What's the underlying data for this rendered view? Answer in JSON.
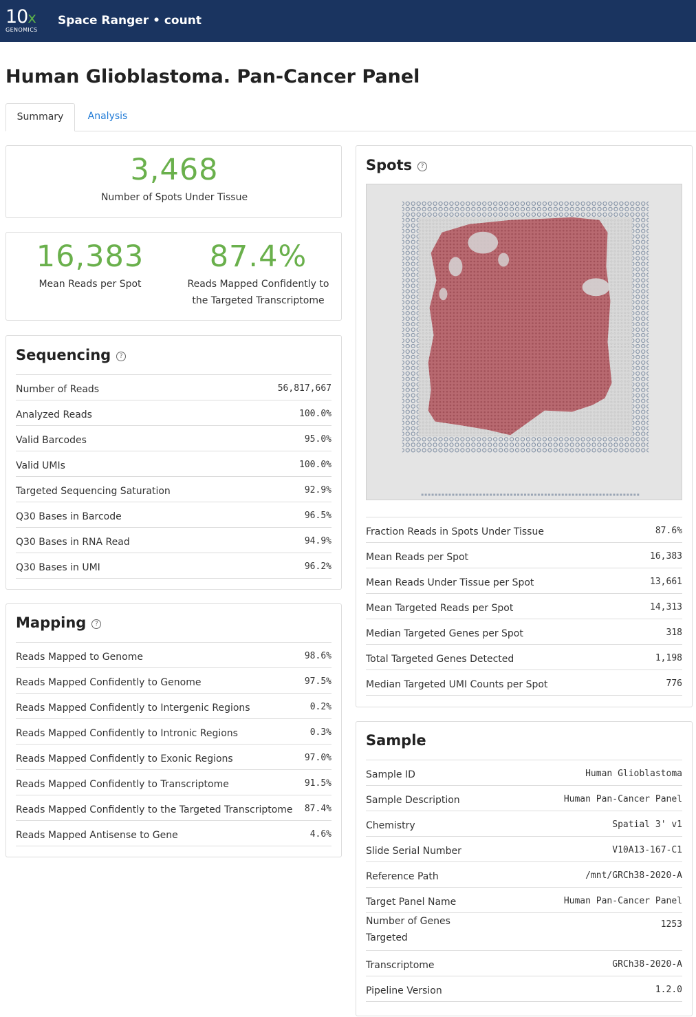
{
  "header": {
    "logo_main": "10",
    "logo_x": "x",
    "logo_sub": "GENOMICS",
    "app_title": "Space Ranger • count"
  },
  "page_title": "Human Glioblastoma. Pan-Cancer Panel",
  "tabs": [
    {
      "label": "Summary",
      "active": true
    },
    {
      "label": "Analysis",
      "active": false
    }
  ],
  "hero": {
    "spots_value": "3,468",
    "spots_label": "Number of Spots Under Tissue",
    "reads_value": "16,383",
    "reads_label": "Mean Reads per Spot",
    "mapped_value": "87.4%",
    "mapped_label_1": "Reads Mapped Confidently to",
    "mapped_label_2": "the Targeted Transcriptome"
  },
  "sequencing": {
    "title": "Sequencing",
    "help_icon": "?",
    "rows": [
      {
        "label": "Number of Reads",
        "value": "56,817,667"
      },
      {
        "label": "Analyzed Reads",
        "value": "100.0%"
      },
      {
        "label": "Valid Barcodes",
        "value": "95.0%"
      },
      {
        "label": "Valid UMIs",
        "value": "100.0%"
      },
      {
        "label": "Targeted Sequencing Saturation",
        "value": "92.9%"
      },
      {
        "label": "Q30 Bases in Barcode",
        "value": "96.5%"
      },
      {
        "label": "Q30 Bases in RNA Read",
        "value": "94.9%"
      },
      {
        "label": "Q30 Bases in UMI",
        "value": "96.2%"
      }
    ]
  },
  "mapping": {
    "title": "Mapping",
    "help_icon": "?",
    "rows": [
      {
        "label": "Reads Mapped to Genome",
        "value": "98.6%"
      },
      {
        "label": "Reads Mapped Confidently to Genome",
        "value": "97.5%"
      },
      {
        "label": "Reads Mapped Confidently to Intergenic Regions",
        "value": "0.2%"
      },
      {
        "label": "Reads Mapped Confidently to Intronic Regions",
        "value": "0.3%"
      },
      {
        "label": "Reads Mapped Confidently to Exonic Regions",
        "value": "97.0%"
      },
      {
        "label": "Reads Mapped Confidently to Transcriptome",
        "value": "91.5%"
      },
      {
        "label": "Reads Mapped Confidently to the Targeted Transcriptome",
        "value": "87.4%"
      },
      {
        "label": "Reads Mapped Antisense to Gene",
        "value": "4.6%"
      }
    ]
  },
  "spots": {
    "title": "Spots",
    "help_icon": "?",
    "rows": [
      {
        "label": "Fraction Reads in Spots Under Tissue",
        "value": "87.6%"
      },
      {
        "label": "Mean Reads per Spot",
        "value": "16,383"
      },
      {
        "label": "Mean Reads Under Tissue per Spot",
        "value": "13,661"
      },
      {
        "label": "Mean Targeted Reads per Spot",
        "value": "14,313"
      },
      {
        "label": "Median Targeted Genes per Spot",
        "value": "318"
      },
      {
        "label": "Total Targeted Genes Detected",
        "value": "1,198"
      },
      {
        "label": "Median Targeted UMI Counts per Spot",
        "value": "776"
      }
    ]
  },
  "sample": {
    "title": "Sample",
    "rows": [
      {
        "label": "Sample ID",
        "value": "Human Glioblastoma"
      },
      {
        "label": "Sample Description",
        "value": "Human Pan-Cancer Panel"
      },
      {
        "label": "Chemistry",
        "value": "Spatial 3' v1"
      },
      {
        "label": "Slide Serial Number",
        "value": "V10A13-167-C1"
      },
      {
        "label": "Reference Path",
        "value": "/mnt/GRCh38-2020-A"
      },
      {
        "label": "Target Panel Name",
        "value": "Human Pan-Cancer Panel"
      },
      {
        "label": "Number of Genes Targeted",
        "value": "1253"
      },
      {
        "label": "Transcriptome",
        "value": "GRCh38-2020-A"
      },
      {
        "label": "Pipeline Version",
        "value": "1.2.0"
      }
    ]
  },
  "colors": {
    "header_bg": "#1a3460",
    "hero_green": "#6ab04c",
    "link_blue": "#1f7ad6",
    "tissue_red": "#a0404a"
  }
}
